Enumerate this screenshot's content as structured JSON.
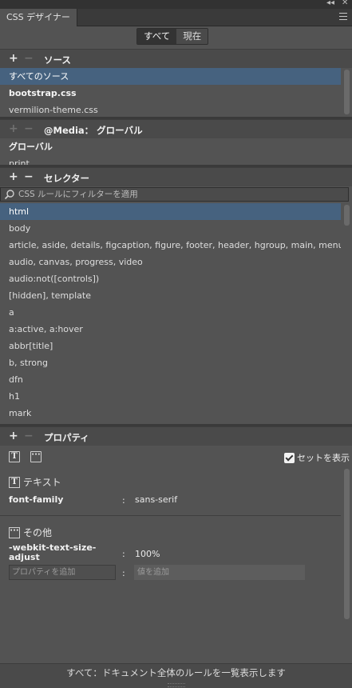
{
  "window": {
    "collapse_glyph": "◂◂",
    "close_glyph": "✕",
    "tab_title": "CSS デザイナー",
    "menu_icon": "hamburger-menu-icon"
  },
  "mode_toggle": {
    "all_label": "すべて",
    "current_label": "現在",
    "selected": "すべて"
  },
  "sources": {
    "title": "ソース",
    "add_glyph": "+",
    "remove_glyph": "−",
    "items": [
      "すべてのソース",
      "bootstrap.css",
      "vermilion-theme.css"
    ]
  },
  "media": {
    "title": "@Media： グローバル",
    "add_glyph": "+",
    "remove_glyph": "−",
    "items": [
      "グローバル",
      "print"
    ]
  },
  "selectors": {
    "title": "セレクター",
    "add_glyph": "+",
    "remove_glyph": "−",
    "filter_placeholder": "CSS ルールにフィルターを適用",
    "items": [
      "html",
      "body",
      "article, aside, details, figcaption, figure, footer, header, hgroup, main, menu, ...",
      "audio, canvas, progress, video",
      "audio:not([controls])",
      "[hidden], template",
      "a",
      "a:active, a:hover",
      "abbr[title]",
      "b, strong",
      "dfn",
      "h1",
      "mark"
    ]
  },
  "properties": {
    "title": "プロパティ",
    "add_glyph": "+",
    "remove_glyph": "−",
    "text_icon_glyph": "T",
    "other_icon_glyph": "···",
    "show_set_label": "セットを表示",
    "show_set_checked": true,
    "groups": {
      "text": {
        "label": "テキスト",
        "prop_name": "font-family",
        "colon": ":",
        "prop_value": "sans-serif"
      },
      "other": {
        "label": "その他",
        "prop_name_line1": "-webkit-text-size-",
        "prop_name_line2": "adjust",
        "colon": ":",
        "prop_value": "100%",
        "add_property_placeholder": "プロパティを追加",
        "add_value_placeholder": "値を追加",
        "add_colon": ":"
      }
    }
  },
  "footer": {
    "text": "すべて：ドキュメント全体のルールを一覧表示します"
  },
  "colors": {
    "panel": "#535353",
    "selected_row": "#46627f",
    "header": "#4a4a4a"
  }
}
